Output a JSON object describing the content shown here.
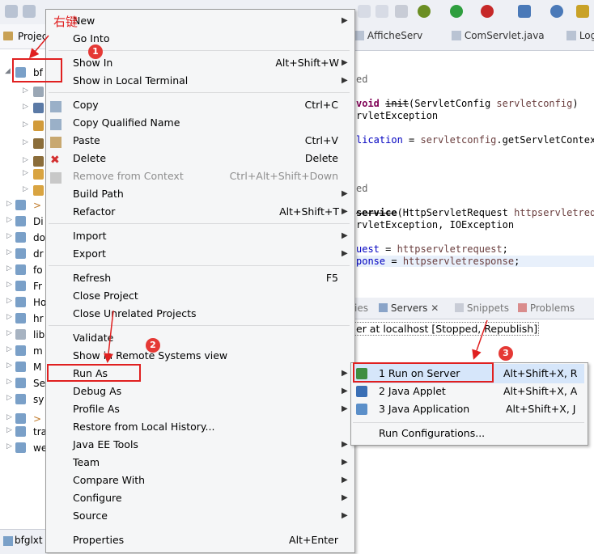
{
  "explorer": {
    "tab_label": "Projec",
    "selected_project": "bf",
    "items": [
      "Di",
      "do",
      "dr",
      "fo",
      "Fr",
      "Ho",
      "hr",
      "lib",
      "m",
      "M",
      "Se",
      "sy",
      "tra",
      "we"
    ],
    "bottom_label": "bfglxt"
  },
  "editor": {
    "tabs": [
      "AfficheServ",
      "ComServlet.java",
      "Log"
    ],
    "lines": [
      {
        "kind": "ann",
        "text": "ed"
      },
      {
        "kind": "init",
        "text_a": "void ",
        "text_b": "init",
        "text_c": "(ServletConfig ",
        "text_d": "servletconfig",
        "text_e": ")"
      },
      {
        "kind": "plain",
        "text": "rvletException"
      },
      {
        "kind": "assign",
        "text_a": "lication",
        "text_b": " = ",
        "text_c": "servletconfig",
        "text_d": ".getServletContext"
      },
      {
        "kind": "ann",
        "text": "ed"
      },
      {
        "kind": "service",
        "text_a": "service",
        "text_b": "(HttpServletRequest ",
        "text_c": "httpservletrequ"
      },
      {
        "kind": "plain",
        "text": "rvletException, IOException"
      },
      {
        "kind": "assign2",
        "text_a": "uest",
        "text_b": " = ",
        "text_c": "httpservletrequest",
        "text_d": ";"
      },
      {
        "kind": "assign2",
        "text_a": "ponse",
        "text_b": " = ",
        "text_c": "httpservletresponse",
        "text_d": ";"
      }
    ]
  },
  "servers": {
    "tabs": [
      "ies",
      "Servers",
      "Snippets",
      "Problems"
    ],
    "server_row": "er at localhost  [Stopped, Republish]"
  },
  "context_menu": {
    "items": [
      {
        "label": "New",
        "shortcut": "",
        "submenu": true
      },
      {
        "label": "Go Into",
        "shortcut": "",
        "submenu": false
      },
      {
        "label": "Show In",
        "shortcut": "Alt+Shift+W",
        "submenu": true
      },
      {
        "label": "Show in Local Terminal",
        "shortcut": "",
        "submenu": true
      },
      {
        "label": "Copy",
        "shortcut": "Ctrl+C",
        "submenu": false
      },
      {
        "label": "Copy Qualified Name",
        "shortcut": "",
        "submenu": false
      },
      {
        "label": "Paste",
        "shortcut": "Ctrl+V",
        "submenu": false
      },
      {
        "label": "Delete",
        "shortcut": "Delete",
        "submenu": false
      },
      {
        "label": "Remove from Context",
        "shortcut": "Ctrl+Alt+Shift+Down",
        "submenu": false
      },
      {
        "label": "Build Path",
        "shortcut": "",
        "submenu": true
      },
      {
        "label": "Refactor",
        "shortcut": "Alt+Shift+T",
        "submenu": true
      },
      {
        "label": "Import",
        "shortcut": "",
        "submenu": true
      },
      {
        "label": "Export",
        "shortcut": "",
        "submenu": true
      },
      {
        "label": "Refresh",
        "shortcut": "F5",
        "submenu": false
      },
      {
        "label": "Close Project",
        "shortcut": "",
        "submenu": false
      },
      {
        "label": "Close Unrelated Projects",
        "shortcut": "",
        "submenu": false
      },
      {
        "label": "Validate",
        "shortcut": "",
        "submenu": false
      },
      {
        "label": "Show in Remote Systems view",
        "shortcut": "",
        "submenu": false
      },
      {
        "label": "Run As",
        "shortcut": "",
        "submenu": true
      },
      {
        "label": "Debug As",
        "shortcut": "",
        "submenu": true
      },
      {
        "label": "Profile As",
        "shortcut": "",
        "submenu": true
      },
      {
        "label": "Restore from Local History...",
        "shortcut": "",
        "submenu": false
      },
      {
        "label": "Java EE Tools",
        "shortcut": "",
        "submenu": true
      },
      {
        "label": "Team",
        "shortcut": "",
        "submenu": true
      },
      {
        "label": "Compare With",
        "shortcut": "",
        "submenu": true
      },
      {
        "label": "Configure",
        "shortcut": "",
        "submenu": true
      },
      {
        "label": "Source",
        "shortcut": "",
        "submenu": true
      },
      {
        "label": "Properties",
        "shortcut": "Alt+Enter",
        "submenu": false
      }
    ]
  },
  "run_as_submenu": {
    "items": [
      {
        "label": "1 Run on Server",
        "shortcut": "Alt+Shift+X, R"
      },
      {
        "label": "2 Java Applet",
        "shortcut": "Alt+Shift+X, A"
      },
      {
        "label": "3 Java Application",
        "shortcut": "Alt+Shift+X, J"
      },
      {
        "label": "Run Configurations...",
        "shortcut": ""
      }
    ]
  },
  "annotations": {
    "right_click_text": "右键",
    "step1": "1",
    "step2": "2",
    "step3": "3"
  },
  "colors": {
    "accent_red": "#e02020",
    "menu_bg": "#f5f6f7",
    "disabled_text": "#8e8e8e"
  }
}
